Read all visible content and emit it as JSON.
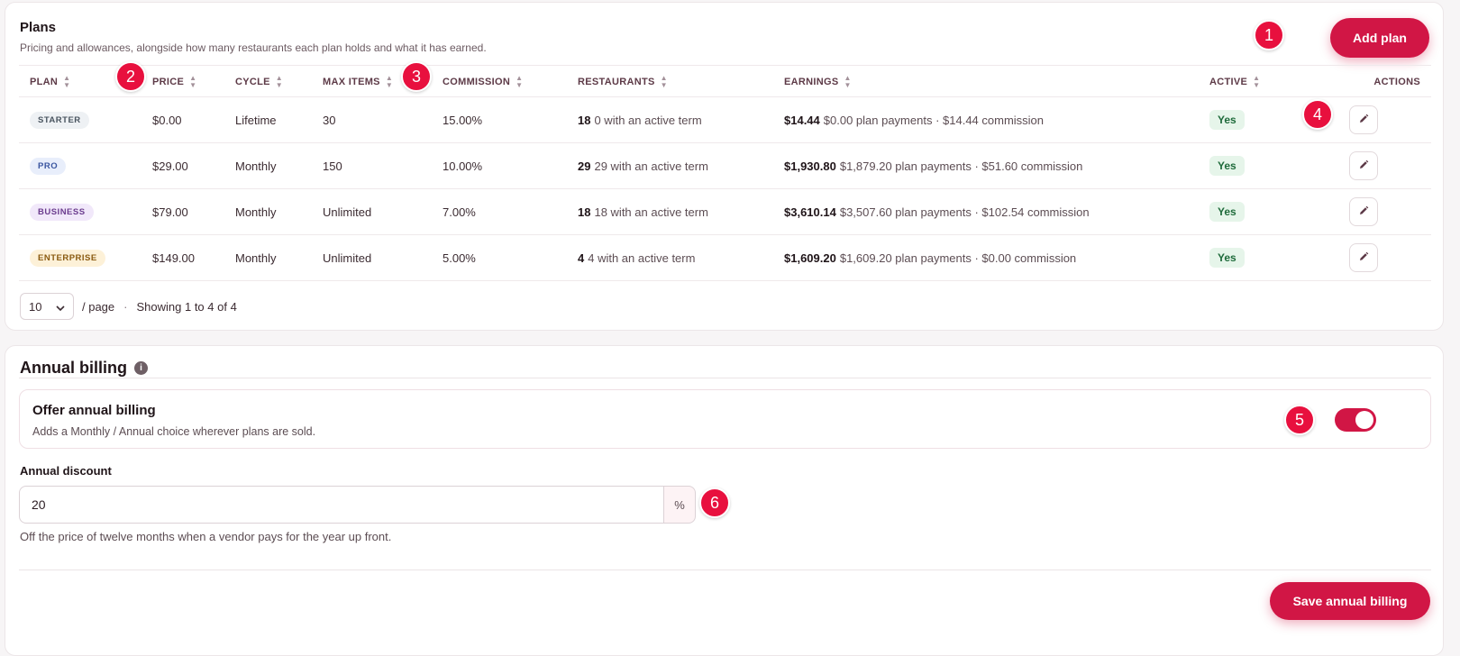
{
  "plans": {
    "title": "Plans",
    "subtitle": "Pricing and allowances, alongside how many restaurants each plan holds and what it has earned.",
    "add_button": "Add plan",
    "columns": [
      "PLAN",
      "PRICE",
      "CYCLE",
      "MAX ITEMS",
      "COMMISSION",
      "RESTAURANTS",
      "EARNINGS",
      "ACTIVE",
      "ACTIONS"
    ],
    "rows": [
      {
        "plan": "STARTER",
        "badge_bg": "#eef1f4",
        "badge_fg": "#4a5560",
        "price": "$0.00",
        "cycle": "Lifetime",
        "max_items": "30",
        "commission": "15.00%",
        "restaurants_count": "18",
        "restaurants_text": "0 with an active term",
        "earnings_total": "$14.44",
        "earnings_detail": "$0.00 plan payments · $14.44 commission",
        "active": "Yes"
      },
      {
        "plan": "PRO",
        "badge_bg": "#e8eefb",
        "badge_fg": "#3a55a0",
        "price": "$29.00",
        "cycle": "Monthly",
        "max_items": "150",
        "commission": "10.00%",
        "restaurants_count": "29",
        "restaurants_text": "29 with an active term",
        "earnings_total": "$1,930.80",
        "earnings_detail": "$1,879.20 plan payments · $51.60 commission",
        "active": "Yes"
      },
      {
        "plan": "BUSINESS",
        "badge_bg": "#f1e8fa",
        "badge_fg": "#6b3c8e",
        "price": "$79.00",
        "cycle": "Monthly",
        "max_items": "Unlimited",
        "commission": "7.00%",
        "restaurants_count": "18",
        "restaurants_text": "18 with an active term",
        "earnings_total": "$3,610.14",
        "earnings_detail": "$3,507.60 plan payments · $102.54 commission",
        "active": "Yes"
      },
      {
        "plan": "ENTERPRISE",
        "badge_bg": "#fdf1d8",
        "badge_fg": "#8a5a10",
        "price": "$149.00",
        "cycle": "Monthly",
        "max_items": "Unlimited",
        "commission": "5.00%",
        "restaurants_count": "4",
        "restaurants_text": "4 with an active term",
        "earnings_total": "$1,609.20",
        "earnings_detail": "$1,609.20 plan payments · $0.00 commission",
        "active": "Yes"
      }
    ],
    "per_page": "10",
    "per_page_label": "/ page",
    "separator": "·",
    "showing": "Showing 1 to 4 of 4"
  },
  "billing": {
    "title": "Annual billing",
    "info_icon": "i",
    "offer_title": "Offer annual billing",
    "offer_sub": "Adds a Monthly / Annual choice wherever plans are sold.",
    "offer_enabled": true,
    "discount_label": "Annual discount",
    "discount_value": "20",
    "discount_suffix": "%",
    "discount_help": "Off the price of twelve months when a vendor pays for the year up front.",
    "save_button": "Save annual billing"
  },
  "markers": [
    "1",
    "2",
    "3",
    "4",
    "5",
    "6"
  ],
  "colors": {
    "accent": "#d11645",
    "marker": "#e8103e",
    "active_bg": "#e6f5ea",
    "active_fg": "#1f6b3b"
  }
}
